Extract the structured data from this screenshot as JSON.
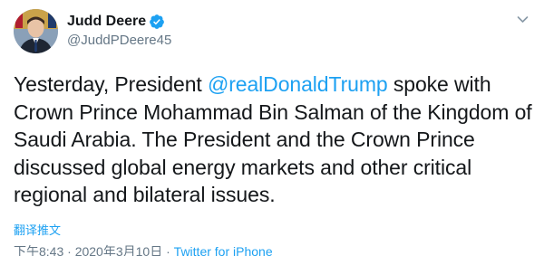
{
  "author": {
    "display_name": "Judd Deere",
    "handle": "@JuddPDeere45",
    "verified_icon": "verified-badge-icon",
    "avatar_icon": "avatar-photo"
  },
  "menu_icon": "chevron-down-icon",
  "tweet": {
    "text_before": "Yesterday, President ",
    "mention": "@realDonaldTrump",
    "text_after": " spoke with Crown Prince Mohammad Bin Salman of the Kingdom of Saudi Arabia.  The President and the Crown Prince discussed global energy markets and other critical regional and bilateral issues."
  },
  "translate_label": "翻译推文",
  "meta": {
    "time": "下午8:43",
    "separator1": " · ",
    "date": "2020年3月10日",
    "separator2": " · ",
    "source": "Twitter for iPhone"
  },
  "colors": {
    "accent": "#1da1f2",
    "text": "#14171a",
    "secondary": "#657786"
  }
}
